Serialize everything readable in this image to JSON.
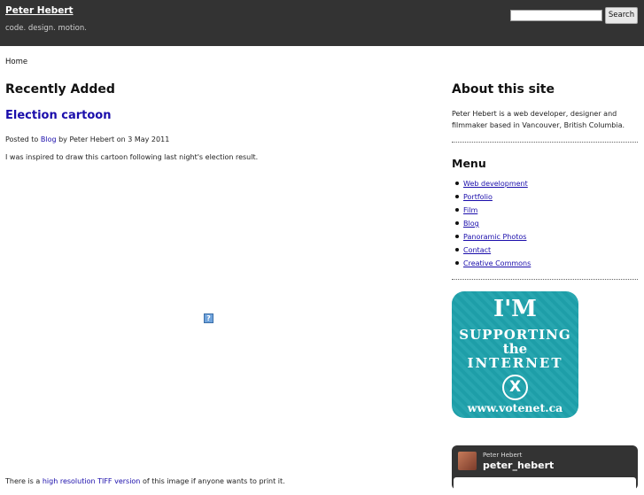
{
  "header": {
    "site_title": "Peter Hebert",
    "tagline": "code. design. motion.",
    "search_placeholder": "",
    "search_button": "Search"
  },
  "breadcrumb": "Home",
  "main": {
    "section_title": "Recently Added",
    "post": {
      "title": "Election cartoon",
      "meta_prefix": "Posted to",
      "meta_category": "Blog",
      "meta_suffix": "by Peter Hebert on 3 May 2011",
      "body": "I was inspired to draw this cartoon following last night's election result.",
      "broken_image_glyph": "?",
      "footer_prefix": "There is a",
      "footer_link": "high resolution TIFF version",
      "footer_suffix": "of this image if anyone wants to print it."
    }
  },
  "sidebar": {
    "about_title": "About this site",
    "about_text": "Peter Hebert is a web developer, designer and filmmaker based in Vancouver, British Columbia.",
    "menu_title": "Menu",
    "menu_items": [
      "Web development",
      "Portfolio",
      "Film",
      "Blog",
      "Panoramic Photos",
      "Contact",
      "Creative Commons"
    ],
    "badge": {
      "line1": "I'M",
      "line2": "SUPPORTING",
      "line3": "the",
      "line4": "INTERNET",
      "mark": "X",
      "url": "www.votenet.ca",
      "color": "#1fa3ad"
    },
    "twitter": {
      "name": "Peter Hebert",
      "handle": "peter_hebert"
    }
  },
  "colors": {
    "header_bg": "#333333",
    "link": "#1a0dab"
  }
}
